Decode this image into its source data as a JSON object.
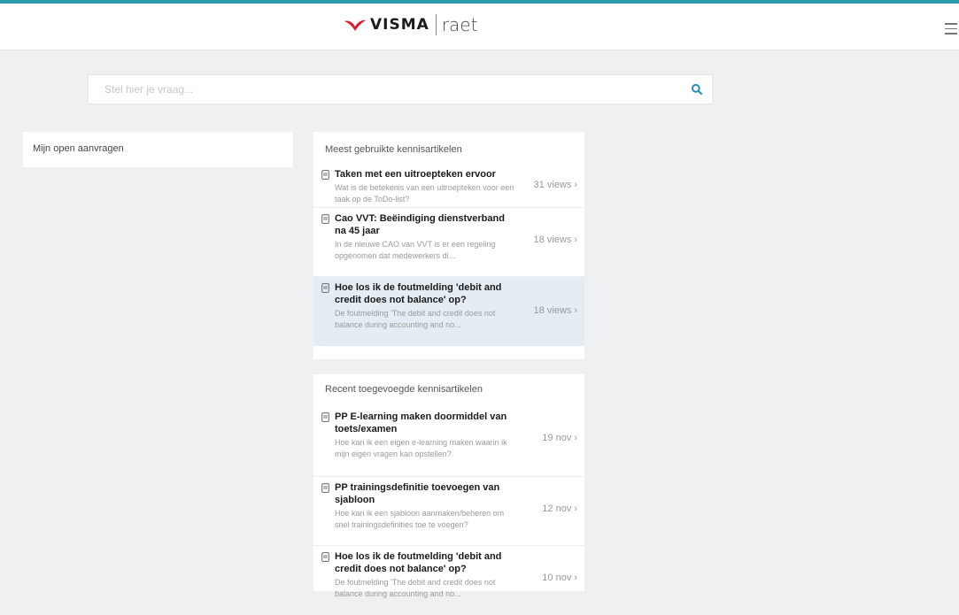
{
  "header": {
    "brand": "VISMA",
    "sub_brand": "raet",
    "menu_icon": "hamburger-menu-icon"
  },
  "search": {
    "placeholder": "Stel hier je vraag...",
    "icon": "search-icon"
  },
  "open_requests": {
    "label": "Mijn open aanvragen"
  },
  "most_used": {
    "title": "Meest gebruikte kennisartikelen",
    "items": [
      {
        "title": "Taken met een uitroepteken ervoor",
        "desc": "Wat is de betekenis van een uitroepteken voor een taak op de ToDo-list?",
        "meta": "31 views"
      },
      {
        "title": "Cao VVT: Beëindiging dienstverband na 45 jaar",
        "desc": "In de nieuwe CAO van VVT is er een regeling opgenomen dat medewerkers di...",
        "meta": "18 views"
      },
      {
        "title": "Hoe los ik de foutmelding 'debit and credit does not balance' op?",
        "desc": "De foutmelding 'The debit and credit does not balance during accounting and no...",
        "meta": "18 views"
      }
    ]
  },
  "recent": {
    "title": "Recent toegevoegde kennisartikelen",
    "items": [
      {
        "title": "PP E-learning maken doormiddel van toets/examen",
        "desc": "Hoe kan ik een eigen e-learning maken waarin ik mijn eigen vragen kan opstellen?",
        "meta": "19 nov"
      },
      {
        "title": "PP trainingsdefinitie toevoegen van sjabloon",
        "desc": "Hoe kan ik een sjabloon aanmaken/beheren om snel trainingsdefinities toe te voegen?",
        "meta": "12 nov"
      },
      {
        "title": "Hoe los ik de foutmelding 'debit and credit does not balance' op?",
        "desc": "De foutmelding 'The debit and credit does not balance during accounting and no...",
        "meta": "10 nov"
      }
    ]
  },
  "colors": {
    "accent": "#2a9aa6",
    "brand_red": "#d6202f",
    "highlight": "#e4edf4"
  }
}
